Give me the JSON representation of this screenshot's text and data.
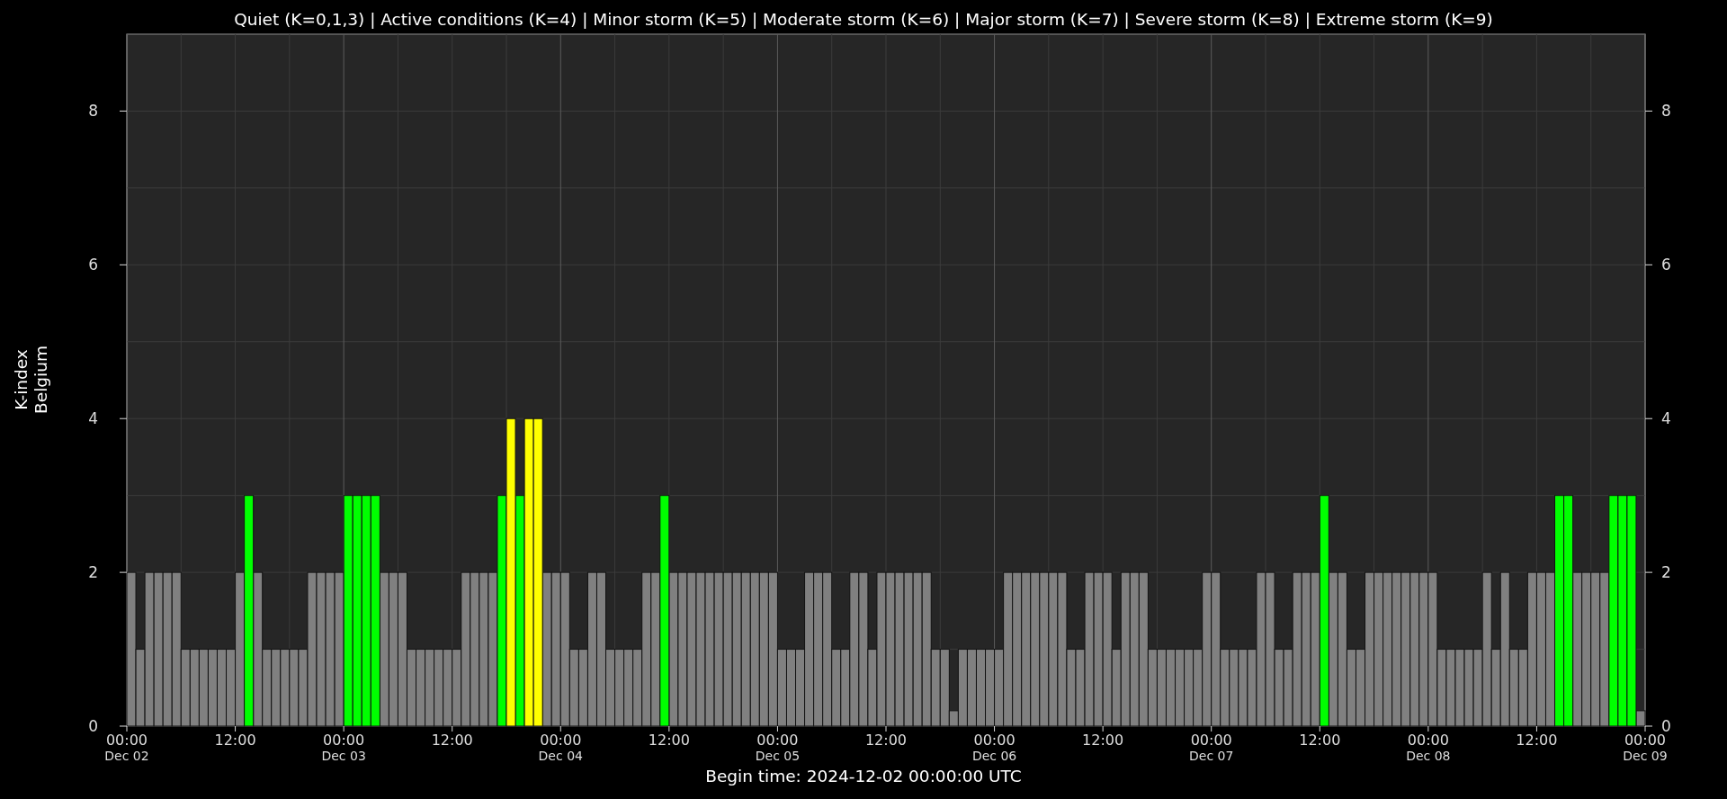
{
  "chart": {
    "chart_data": {
      "type": "bar",
      "title": "Quiet (K=0,1,3) | Active conditions (K=4) | Minor storm (K=5) | Moderate storm (K=6) | Major storm (K=7) | Severe storm (K=8) | Extreme storm (K=9)",
      "xlabel": "Begin time: 2024-12-02 00:00:00 UTC",
      "ylabel": "K-index\nBelgium",
      "grid": true,
      "ylim": [
        0,
        9
      ],
      "y2lim": [
        0,
        9
      ],
      "yticks": [
        0,
        2,
        4,
        6,
        8
      ],
      "y2ticks": [
        0,
        2,
        4,
        6,
        8
      ],
      "categories": [
        "00:00$_{Dec 02}$",
        null,
        null,
        null,
        null,
        null,
        null,
        null,
        null,
        null,
        null,
        null,
        "12:00",
        null,
        null,
        null,
        null,
        null,
        null,
        null,
        null,
        null,
        null,
        null,
        "00:00$_{Dec 03}$",
        null,
        null,
        null,
        null,
        null,
        null,
        null,
        null,
        null,
        null,
        null,
        "12:00",
        null,
        null,
        null,
        null,
        null,
        null,
        null,
        null,
        null,
        null,
        null,
        "00:00$_{Dec 04}$",
        null,
        null,
        null,
        null,
        null,
        null,
        null,
        null,
        null,
        null,
        null,
        "12:00",
        null,
        null,
        null,
        null,
        null,
        null,
        null,
        null,
        null,
        null,
        null,
        "00:00$_{Dec 05}$",
        null,
        null,
        null,
        null,
        null,
        null,
        null,
        null,
        null,
        null,
        null,
        "12:00",
        null,
        null,
        null,
        null,
        null,
        null,
        null,
        null,
        null,
        null,
        null,
        "00:00$_{Dec 06}$",
        null,
        null,
        null,
        null,
        null,
        null,
        null,
        null,
        null,
        null,
        null,
        "12:00",
        null,
        null,
        null,
        null,
        null,
        null,
        null,
        null,
        null,
        null,
        null,
        "00:00$_{Dec 07}$",
        null,
        null,
        null,
        null,
        null,
        null,
        null,
        null,
        null,
        null,
        null,
        "12:00",
        null,
        null,
        null,
        null,
        null,
        null,
        null,
        null,
        null,
        null,
        null,
        "00:00$_{Dec 08}$",
        null,
        null,
        null,
        null,
        null,
        null,
        null,
        null,
        null,
        null,
        null,
        "12:00",
        null,
        null,
        null,
        null,
        null,
        null,
        null,
        null,
        null,
        null,
        null,
        "00:00$_{Dec 09}$"
      ],
      "series": [
        {
          "color": "#808080",
          "values": [
            2,
            1,
            2,
            2,
            2,
            2,
            1,
            1,
            1,
            1,
            1,
            1,
            2,
            null,
            2,
            1,
            1,
            1,
            1,
            1,
            2,
            2,
            2,
            2,
            null,
            null,
            null,
            null,
            2,
            2,
            2,
            1,
            1,
            1,
            1,
            1,
            1,
            2,
            2,
            2,
            2,
            null,
            null,
            null,
            null,
            null,
            2,
            2,
            2,
            1,
            1,
            2,
            2,
            1,
            1,
            1,
            1,
            2,
            2,
            null,
            2,
            2,
            2,
            2,
            2,
            2,
            2,
            2,
            2,
            2,
            2,
            2,
            1,
            1,
            1,
            2,
            2,
            2,
            1,
            1,
            2,
            2,
            1,
            2,
            2,
            2,
            2,
            2,
            2,
            1,
            1,
            0.2,
            1,
            1,
            1,
            1,
            1,
            2,
            2,
            2,
            2,
            2,
            2,
            2,
            1,
            1,
            2,
            2,
            2,
            1,
            2,
            2,
            2,
            1,
            1,
            1,
            1,
            1,
            1,
            2,
            2,
            1,
            1,
            1,
            1,
            2,
            2,
            1,
            1,
            2,
            2,
            2,
            null,
            2,
            2,
            1,
            1,
            2,
            2,
            2,
            2,
            2,
            2,
            2,
            2,
            1,
            1,
            1,
            1,
            1,
            2,
            1,
            2,
            1,
            1,
            2,
            2,
            2,
            null,
            null,
            2,
            2,
            2,
            2,
            null,
            null,
            null,
            0.2,
            null
          ]
        },
        {
          "color": "#00ff00",
          "values": [
            null,
            null,
            null,
            null,
            null,
            null,
            null,
            null,
            null,
            null,
            null,
            null,
            null,
            3,
            null,
            null,
            null,
            null,
            null,
            null,
            null,
            null,
            null,
            null,
            3,
            3,
            3,
            3,
            null,
            null,
            null,
            null,
            null,
            null,
            null,
            null,
            null,
            null,
            null,
            null,
            null,
            3,
            null,
            3,
            null,
            null,
            null,
            null,
            null,
            null,
            null,
            null,
            null,
            null,
            null,
            null,
            null,
            null,
            null,
            3,
            null,
            null,
            null,
            null,
            null,
            null,
            null,
            null,
            null,
            null,
            null,
            null,
            null,
            null,
            null,
            null,
            null,
            null,
            null,
            null,
            null,
            null,
            null,
            null,
            null,
            null,
            null,
            null,
            null,
            null,
            null,
            null,
            null,
            null,
            null,
            null,
            null,
            null,
            null,
            null,
            null,
            null,
            null,
            null,
            null,
            null,
            null,
            null,
            null,
            null,
            null,
            null,
            null,
            null,
            null,
            null,
            null,
            null,
            null,
            null,
            null,
            null,
            null,
            null,
            null,
            null,
            null,
            null,
            null,
            null,
            null,
            null,
            3,
            null,
            null,
            null,
            null,
            null,
            null,
            null,
            null,
            null,
            null,
            null,
            null,
            null,
            null,
            null,
            null,
            null,
            null,
            null,
            null,
            null,
            null,
            null,
            null,
            null,
            3,
            3,
            null,
            null,
            null,
            null,
            3,
            3,
            3,
            null,
            null
          ]
        },
        {
          "color": "#ffff00",
          "values": [
            null,
            null,
            null,
            null,
            null,
            null,
            null,
            null,
            null,
            null,
            null,
            null,
            null,
            null,
            null,
            null,
            null,
            null,
            null,
            null,
            null,
            null,
            null,
            null,
            null,
            null,
            null,
            null,
            null,
            null,
            null,
            null,
            null,
            null,
            null,
            null,
            null,
            null,
            null,
            null,
            null,
            null,
            4,
            null,
            4,
            4,
            null,
            null,
            null,
            null,
            null,
            null,
            null,
            null,
            null,
            null,
            null,
            null,
            null,
            null,
            null,
            null,
            null,
            null,
            null,
            null,
            null,
            null,
            null,
            null,
            null,
            null,
            null,
            null,
            null,
            null,
            null,
            null,
            null,
            null,
            null,
            null,
            null,
            null,
            null,
            null,
            null,
            null,
            null,
            null,
            null,
            null,
            null,
            null,
            null,
            null,
            null,
            null,
            null,
            null,
            null,
            null,
            null,
            null,
            null,
            null,
            null,
            null,
            null,
            null,
            null,
            null,
            null,
            null,
            null,
            null,
            null,
            null,
            null,
            null,
            null,
            null,
            null,
            null,
            null,
            null,
            null,
            null,
            null,
            null,
            null,
            null,
            null,
            null,
            null,
            null,
            null,
            null,
            null,
            null,
            null,
            null,
            null,
            null,
            null,
            null,
            null,
            null,
            null,
            null,
            null,
            null,
            null,
            null,
            null,
            null,
            null,
            null,
            null,
            null,
            null,
            null,
            null,
            null,
            null,
            null,
            null,
            null,
            null
          ]
        }
      ]
    }
  }
}
